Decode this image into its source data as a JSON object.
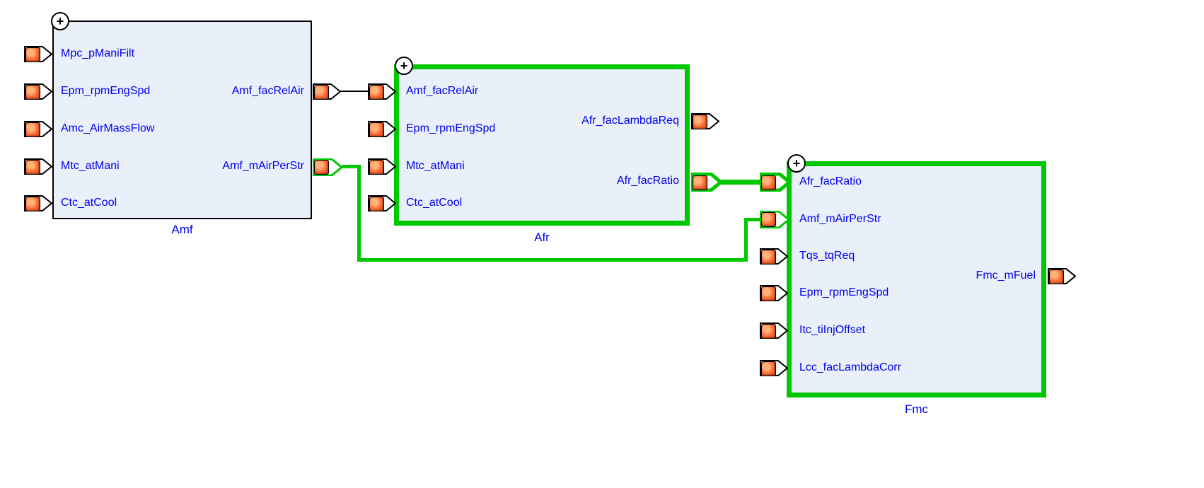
{
  "blocks": {
    "amf": {
      "name": "Amf",
      "inputs": [
        "Mpc_pManiFilt",
        "Epm_rpmEngSpd",
        "Amc_AirMassFlow",
        "Mtc_atMani",
        "Ctc_atCool"
      ],
      "outputs": [
        "Amf_facRelAir",
        "Amf_mAirPerStr"
      ]
    },
    "afr": {
      "name": "Afr",
      "inputs": [
        "Amf_facRelAir",
        "Epm_rpmEngSpd",
        "Mtc_atMani",
        "Ctc_atCool"
      ],
      "outputs": [
        "Afr_facLambdaReq",
        "Afr_facRatio"
      ]
    },
    "fmc": {
      "name": "Fmc",
      "inputs": [
        "Afr_facRatio",
        "Amf_mAirPerStr",
        "Tqs_tqReq",
        "Epm_rpmEngSpd",
        "Itc_tiInjOffset",
        "Lcc_facLambdaCorr"
      ],
      "outputs": [
        "Fmc_mFuel"
      ]
    }
  }
}
